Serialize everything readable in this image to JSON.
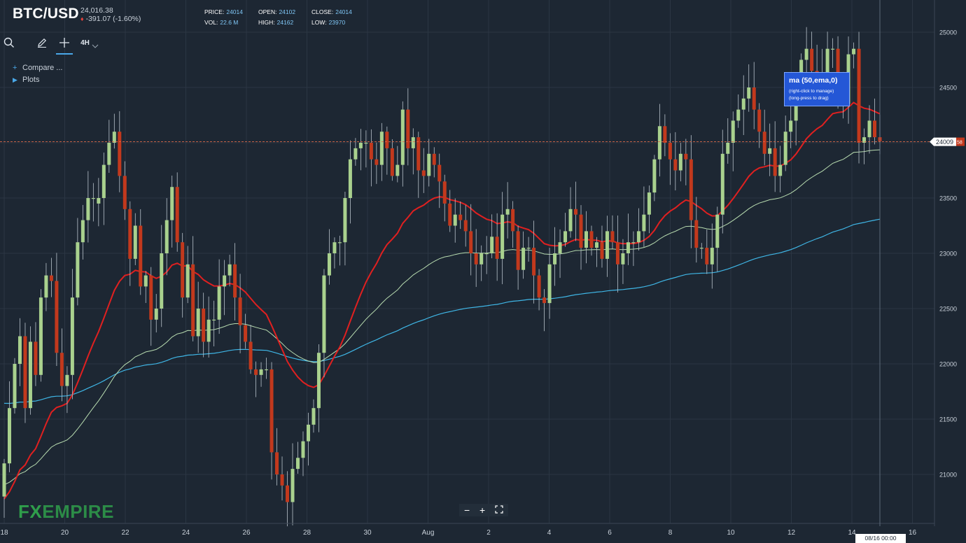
{
  "header": {
    "symbol": "BTC/USD",
    "last": "24,016.38",
    "change": "-391.07 (-1.60%)",
    "change_arrow": "♦"
  },
  "ohlc": {
    "price_label": "PRICE:",
    "price": "24014",
    "open_label": "OPEN:",
    "open": "24102",
    "close_label": "CLOSE:",
    "close": "24014",
    "vol_label": "VOL:",
    "vol": "22.6 M",
    "high_label": "HIGH:",
    "high": "24162",
    "low_label": "LOW:",
    "low": "23970"
  },
  "toolbar": {
    "icons": [
      "search-icon",
      "pencil-icon",
      "crosshair-icon"
    ],
    "interval": "4H"
  },
  "menu": {
    "compare": "Compare ...",
    "plots": "Plots"
  },
  "tooltip": {
    "title": "ma (50,ema,0)",
    "line1": "(right-click to manage)",
    "line2": "(long-press to drag)"
  },
  "zoom": {
    "minus": "−",
    "plus": "+",
    "fit_icon": "fit-screen-icon"
  },
  "logo": {
    "fx": "FX",
    "empire": "EMPIRE"
  },
  "price_tag": "24009",
  "price_tag_suffix": "58",
  "crosshair_date": "08/16 00:00",
  "colors": {
    "background": "#1d2733",
    "up": "#a9d18e",
    "down": "#c2391d",
    "ema50": "#e02020",
    "ma_green": "#b8dcb0",
    "ma_blue": "#3fb6e6",
    "grid": "#2b3643"
  },
  "chart_data": {
    "type": "candlestick",
    "y_ticks": [
      21000,
      21500,
      22000,
      22500,
      23000,
      23500,
      24000,
      24500,
      25000
    ],
    "x_ticks": [
      "18",
      "20",
      "22",
      "24",
      "26",
      "28",
      "30",
      "Aug",
      "2",
      "4",
      "6",
      "8",
      "10",
      "12",
      "14",
      "16"
    ],
    "ylim": [
      20600,
      25250
    ],
    "current_price": 24009,
    "candles_close": [
      21100,
      21600,
      22000,
      22250,
      21600,
      22200,
      21900,
      22600,
      22800,
      22750,
      22100,
      21800,
      21900,
      22600,
      23100,
      23300,
      23500,
      23500,
      23500,
      23800,
      24000,
      24100,
      23700,
      23400,
      22950,
      23250,
      22700,
      22800,
      22400,
      22500,
      23000,
      23300,
      23600,
      23100,
      22600,
      22900,
      22250,
      22500,
      22200,
      22400,
      22400,
      22700,
      22800,
      22900,
      22600,
      22350,
      22200,
      21950,
      21900,
      21950,
      21950,
      21200,
      21000,
      20900,
      20750,
      21050,
      21150,
      21300,
      21450,
      21600,
      22100,
      22800,
      23000,
      23100,
      23100,
      23500,
      23850,
      23950,
      24000,
      24000,
      23850,
      23800,
      24100,
      23950,
      23700,
      23800,
      24300,
      23950,
      24050,
      23750,
      23700,
      23900,
      23800,
      23650,
      23450,
      23250,
      23350,
      23300,
      23200,
      23000,
      22900,
      23000,
      23000,
      23150,
      22950,
      23350,
      23400,
      23200,
      22850,
      23050,
      23050,
      22800,
      22600,
      22550,
      22900,
      23000,
      23100,
      23200,
      23400,
      23350,
      23050,
      23200,
      23050,
      23100,
      22950,
      23200,
      23100,
      22900,
      23000,
      23100,
      23100,
      23200,
      23350,
      23550,
      23850,
      24150,
      24000,
      23850,
      23750,
      23900,
      23850,
      23300,
      23050,
      23050,
      22900,
      23050,
      23350,
      23900,
      24000,
      24200,
      24300,
      24400,
      24500,
      24300,
      24100,
      23900,
      23950,
      23700,
      23800,
      24100,
      24200,
      24500,
      24750,
      24850,
      24650,
      24600,
      24500,
      24850,
      24850,
      24400,
      24350,
      24800,
      24850,
      24000,
      24050,
      24200,
      24050,
      24014
    ],
    "candles_open": [
      20800,
      21100,
      21600,
      22000,
      22250,
      21600,
      22200,
      21900,
      22600,
      22800,
      22750,
      22100,
      21800,
      21900,
      22600,
      23100,
      23300,
      23500,
      23450,
      23500,
      23800,
      24000,
      24100,
      23700,
      23400,
      22950,
      23250,
      22700,
      22800,
      22400,
      22500,
      23000,
      23300,
      23600,
      23100,
      22600,
      22900,
      22250,
      22500,
      22200,
      22400,
      22400,
      22700,
      22800,
      22900,
      22600,
      22350,
      22200,
      21950,
      21900,
      21950,
      21950,
      21200,
      21000,
      20900,
      20750,
      21050,
      21150,
      21300,
      21450,
      21600,
      22100,
      22800,
      23000,
      23100,
      23100,
      23500,
      23850,
      23950,
      24000,
      24000,
      23850,
      23800,
      24100,
      23950,
      23700,
      23800,
      24300,
      23950,
      24050,
      23750,
      23700,
      23900,
      23800,
      23650,
      23450,
      23250,
      23350,
      23300,
      23200,
      23000,
      22900,
      23000,
      23000,
      23150,
      22950,
      23350,
      23400,
      23200,
      22850,
      23050,
      23050,
      22800,
      22600,
      22550,
      22900,
      23000,
      23100,
      23200,
      23400,
      23350,
      23050,
      23200,
      23050,
      23100,
      22950,
      23200,
      23100,
      22900,
      23000,
      23100,
      23100,
      23200,
      23350,
      23550,
      23850,
      24150,
      24000,
      23850,
      23750,
      23900,
      23850,
      23300,
      23050,
      23050,
      22900,
      23050,
      23350,
      23900,
      24000,
      24200,
      24300,
      24400,
      24500,
      24300,
      24100,
      23900,
      23950,
      23700,
      23800,
      24100,
      24200,
      24500,
      24750,
      24850,
      24650,
      24600,
      24500,
      24850,
      24850,
      24400,
      24350,
      24800,
      24850,
      24000,
      24050,
      24200,
      24050
    ]
  }
}
